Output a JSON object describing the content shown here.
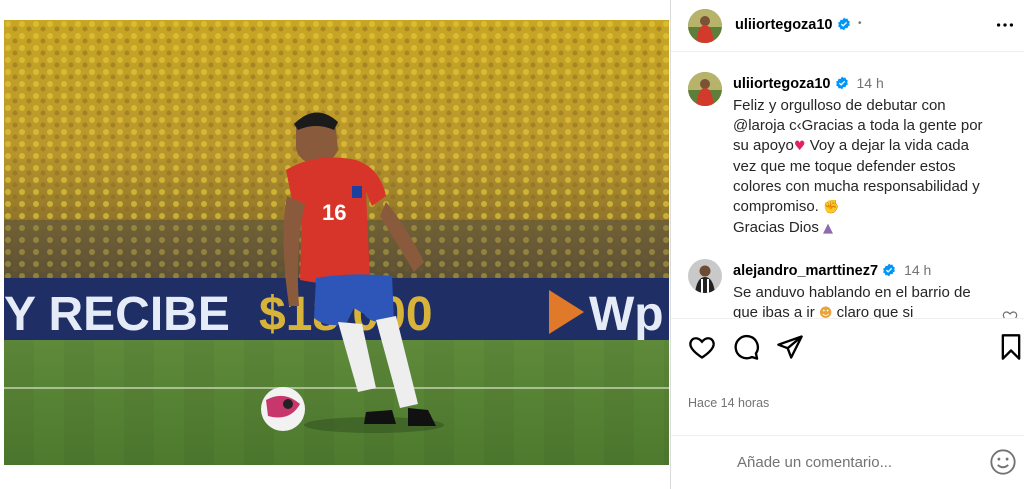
{
  "post": {
    "username": "uliiortegoza10",
    "header_dot": "•"
  },
  "caption": {
    "username": "uliiortegoza10",
    "time": "14 h",
    "line1": "Feliz y orgulloso de debutar con",
    "mention": "@laroja",
    "line2": " c‹Gracias a toda la gente por",
    "line3": "su apoyo",
    "line3b": " Voy a dejar la vida cada",
    "line4": "vez que me toque defender estos",
    "line5": "colores con mucha responsabilidad y",
    "line6": "compromiso. ",
    "line7": "Gracias Dios "
  },
  "comment": {
    "username": "alejandro_marttinez7",
    "time": "14 h",
    "line1": "Se anduvo hablando en el barrio de",
    "line2a": "que ibas a ir ",
    "line2b": " claro que si"
  },
  "timestamp": "Hace 14 horas",
  "add_comment": {
    "placeholder": "Añade un comentario..."
  },
  "icons": {
    "like": "heart-icon",
    "comment": "comment-icon",
    "share": "share-icon",
    "save": "bookmark-icon",
    "emoji": "emoji-icon",
    "more": "more-options-icon"
  },
  "colors": {
    "verified": "#0095f6",
    "secondary_text": "#737373",
    "border": "#dbdbdb"
  }
}
